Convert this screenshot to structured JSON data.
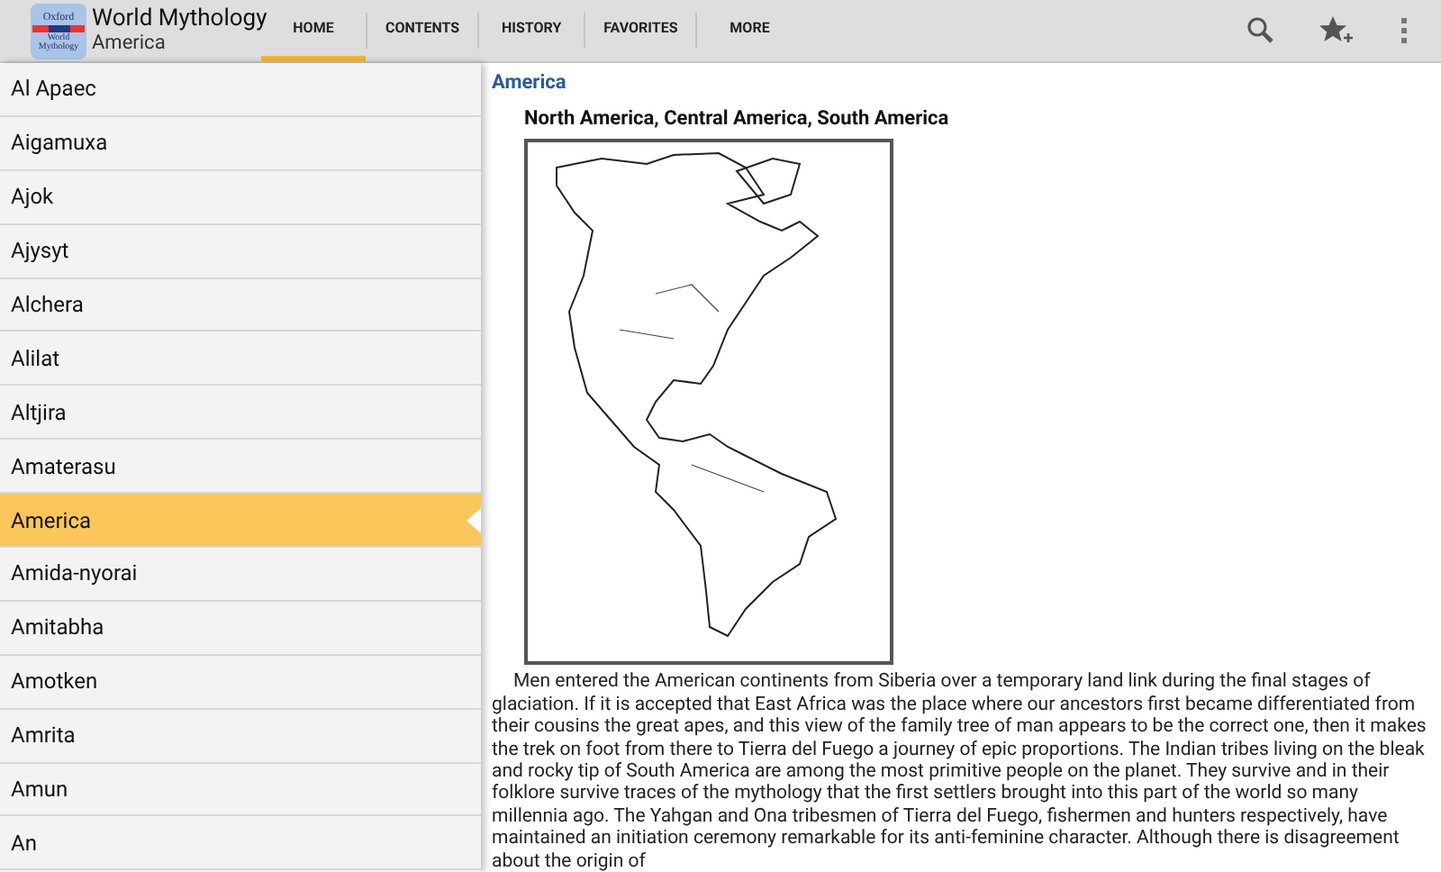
{
  "app_bar": {
    "logo": {
      "line_1": "Oxford",
      "line_2": "World",
      "line_3": "Mythology"
    },
    "title": "World Mythology",
    "subtitle": "America"
  },
  "tabs": [
    {
      "label": "HOME",
      "selected": true
    },
    {
      "label": "CONTENTS",
      "selected": false
    },
    {
      "label": "HISTORY",
      "selected": false
    },
    {
      "label": "FAVORITES",
      "selected": false
    },
    {
      "label": "MORE",
      "selected": false
    }
  ],
  "sidebar": {
    "items": [
      {
        "label": "Al Apaec",
        "selected": false
      },
      {
        "label": "Aigamuxa",
        "selected": false
      },
      {
        "label": "Ajok",
        "selected": false
      },
      {
        "label": "Ajysyt",
        "selected": false
      },
      {
        "label": "Alchera",
        "selected": false
      },
      {
        "label": "Alilat",
        "selected": false
      },
      {
        "label": "Altjira",
        "selected": false
      },
      {
        "label": "Amaterasu",
        "selected": false
      },
      {
        "label": "America",
        "selected": true
      },
      {
        "label": "Amida-nyorai",
        "selected": false
      },
      {
        "label": "Amitabha",
        "selected": false
      },
      {
        "label": "Amotken",
        "selected": false
      },
      {
        "label": "Amrita",
        "selected": false
      },
      {
        "label": "Amun",
        "selected": false
      },
      {
        "label": "An",
        "selected": false
      }
    ]
  },
  "article": {
    "title": "America",
    "heading": "North America, Central America, South America",
    "body": "Men entered the American continents from Siberia over a temporary land link during the final stages of glaciation. If it is accepted that East Africa was the place where our ancestors first became differentiated from their cousins the great apes, and this view of the family tree of man appears to be the correct one, then it makes the trek on foot from there to Tierra del Fuego a journey of epic proportions. The Indian tribes living on the bleak and rocky tip of South America are among the most primitive people on the planet. They survive and in their folklore survive traces of the mythology that the first settlers brought into this part of the world so many millennia ago. The Yahgan and Ona tribesmen of Tierra del Fuego, fishermen and hunters respectively, have maintained an initiation ceremony remarkable for its anti-feminine character. Although there is disagreement about the origin of"
  }
}
